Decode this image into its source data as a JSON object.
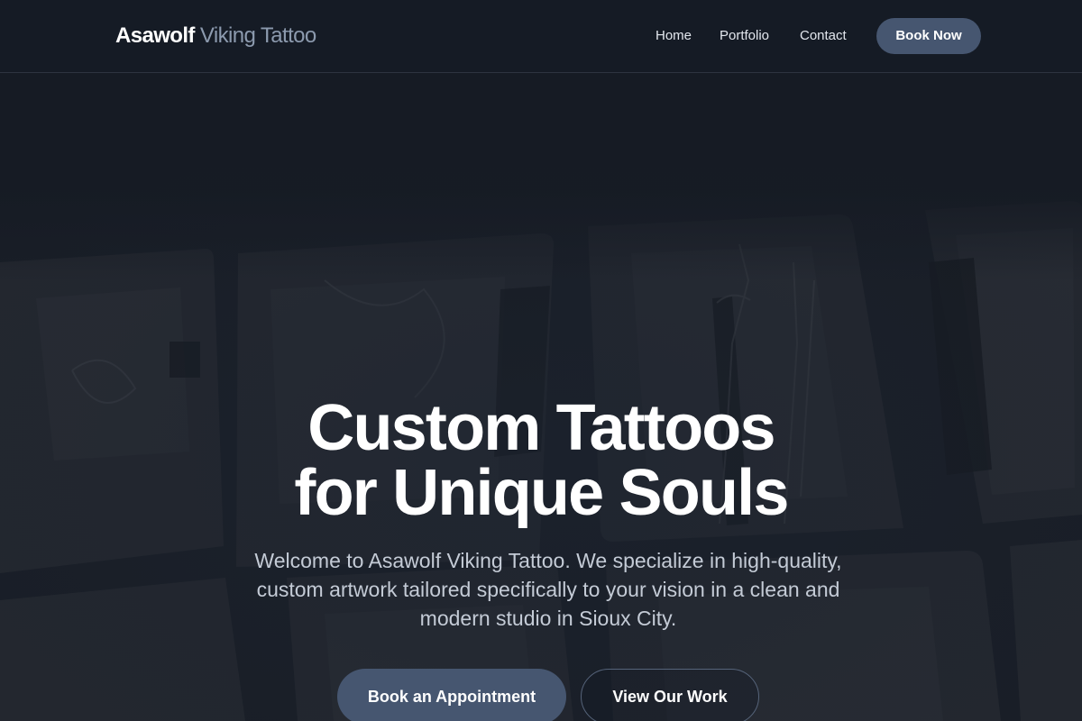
{
  "header": {
    "brand_strong": "Asawolf",
    "brand_light": "Viking Tattoo",
    "nav": {
      "home": "Home",
      "portfolio": "Portfolio",
      "contact": "Contact"
    },
    "cta": "Book Now"
  },
  "hero": {
    "title_line1": "Custom Tattoos",
    "title_line2": "for Unique Souls",
    "subtitle": "Welcome to Asawolf Viking Tattoo. We specialize in high-quality, custom artwork tailored specifically to your vision in a clean and modern studio in Sioux City.",
    "primary_button": "Book an Appointment",
    "secondary_button": "View Our Work",
    "background": "tattoo-portfolio-photo-collage"
  },
  "colors": {
    "page_background": "#151a23",
    "button_accent": "#465670",
    "brand_muted": "#8c9aae",
    "text_primary": "#ffffff",
    "text_secondary": "#c4cbd6"
  }
}
